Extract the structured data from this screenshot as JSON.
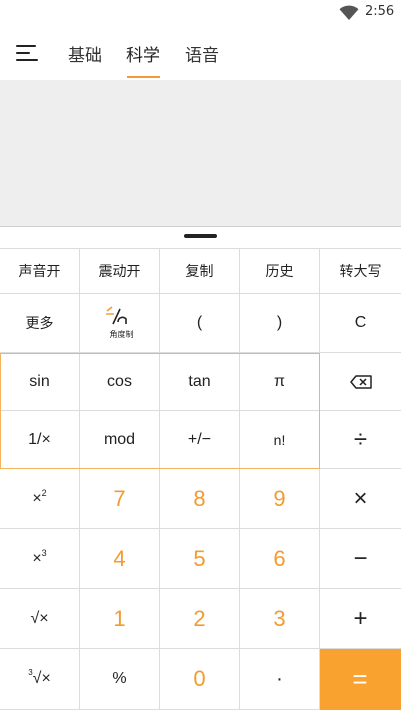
{
  "status_bar": {
    "time": "2:56",
    "wifi_icon": "wifi-icon"
  },
  "nav": {
    "menu_icon": "hamburger-menu-icon",
    "tabs": [
      {
        "label": "基础",
        "active": false
      },
      {
        "label": "科学",
        "active": true
      },
      {
        "label": "语音",
        "active": false
      }
    ],
    "accent_color": "#f29b30"
  },
  "display": {
    "expression": "",
    "result": ""
  },
  "keypad": {
    "row1": [
      "声音开",
      "震动开",
      "复制",
      "历史",
      "转大写"
    ],
    "row2": {
      "more": "更多",
      "angle_sub": "角度制",
      "lparen": "(",
      "rparen": ")",
      "clear": "C"
    },
    "row3": {
      "sin": "sin",
      "cos": "cos",
      "tan": "tan",
      "pi": "π",
      "backspace_icon": "backspace-icon"
    },
    "row4": {
      "reciprocal": "1/×",
      "mod": "mod",
      "negate": "+/−",
      "factorial": "n!",
      "divide": "÷"
    },
    "row5": {
      "square_base": "×",
      "square_exp": "2",
      "n7": "7",
      "n8": "8",
      "n9": "9",
      "multiply": "×"
    },
    "row6": {
      "cube_base": "×",
      "cube_exp": "3",
      "n4": "4",
      "n5": "5",
      "n6": "6",
      "minus": "−"
    },
    "row7": {
      "sqrt": "√×",
      "n1": "1",
      "n2": "2",
      "n3": "3",
      "plus": "+"
    },
    "row8": {
      "cbrt_index": "3",
      "cbrt": "√×",
      "percent": "%",
      "n0": "0",
      "dot": "·",
      "equals": "="
    },
    "equals_color": "#f9a230",
    "number_color": "#f29b30"
  }
}
